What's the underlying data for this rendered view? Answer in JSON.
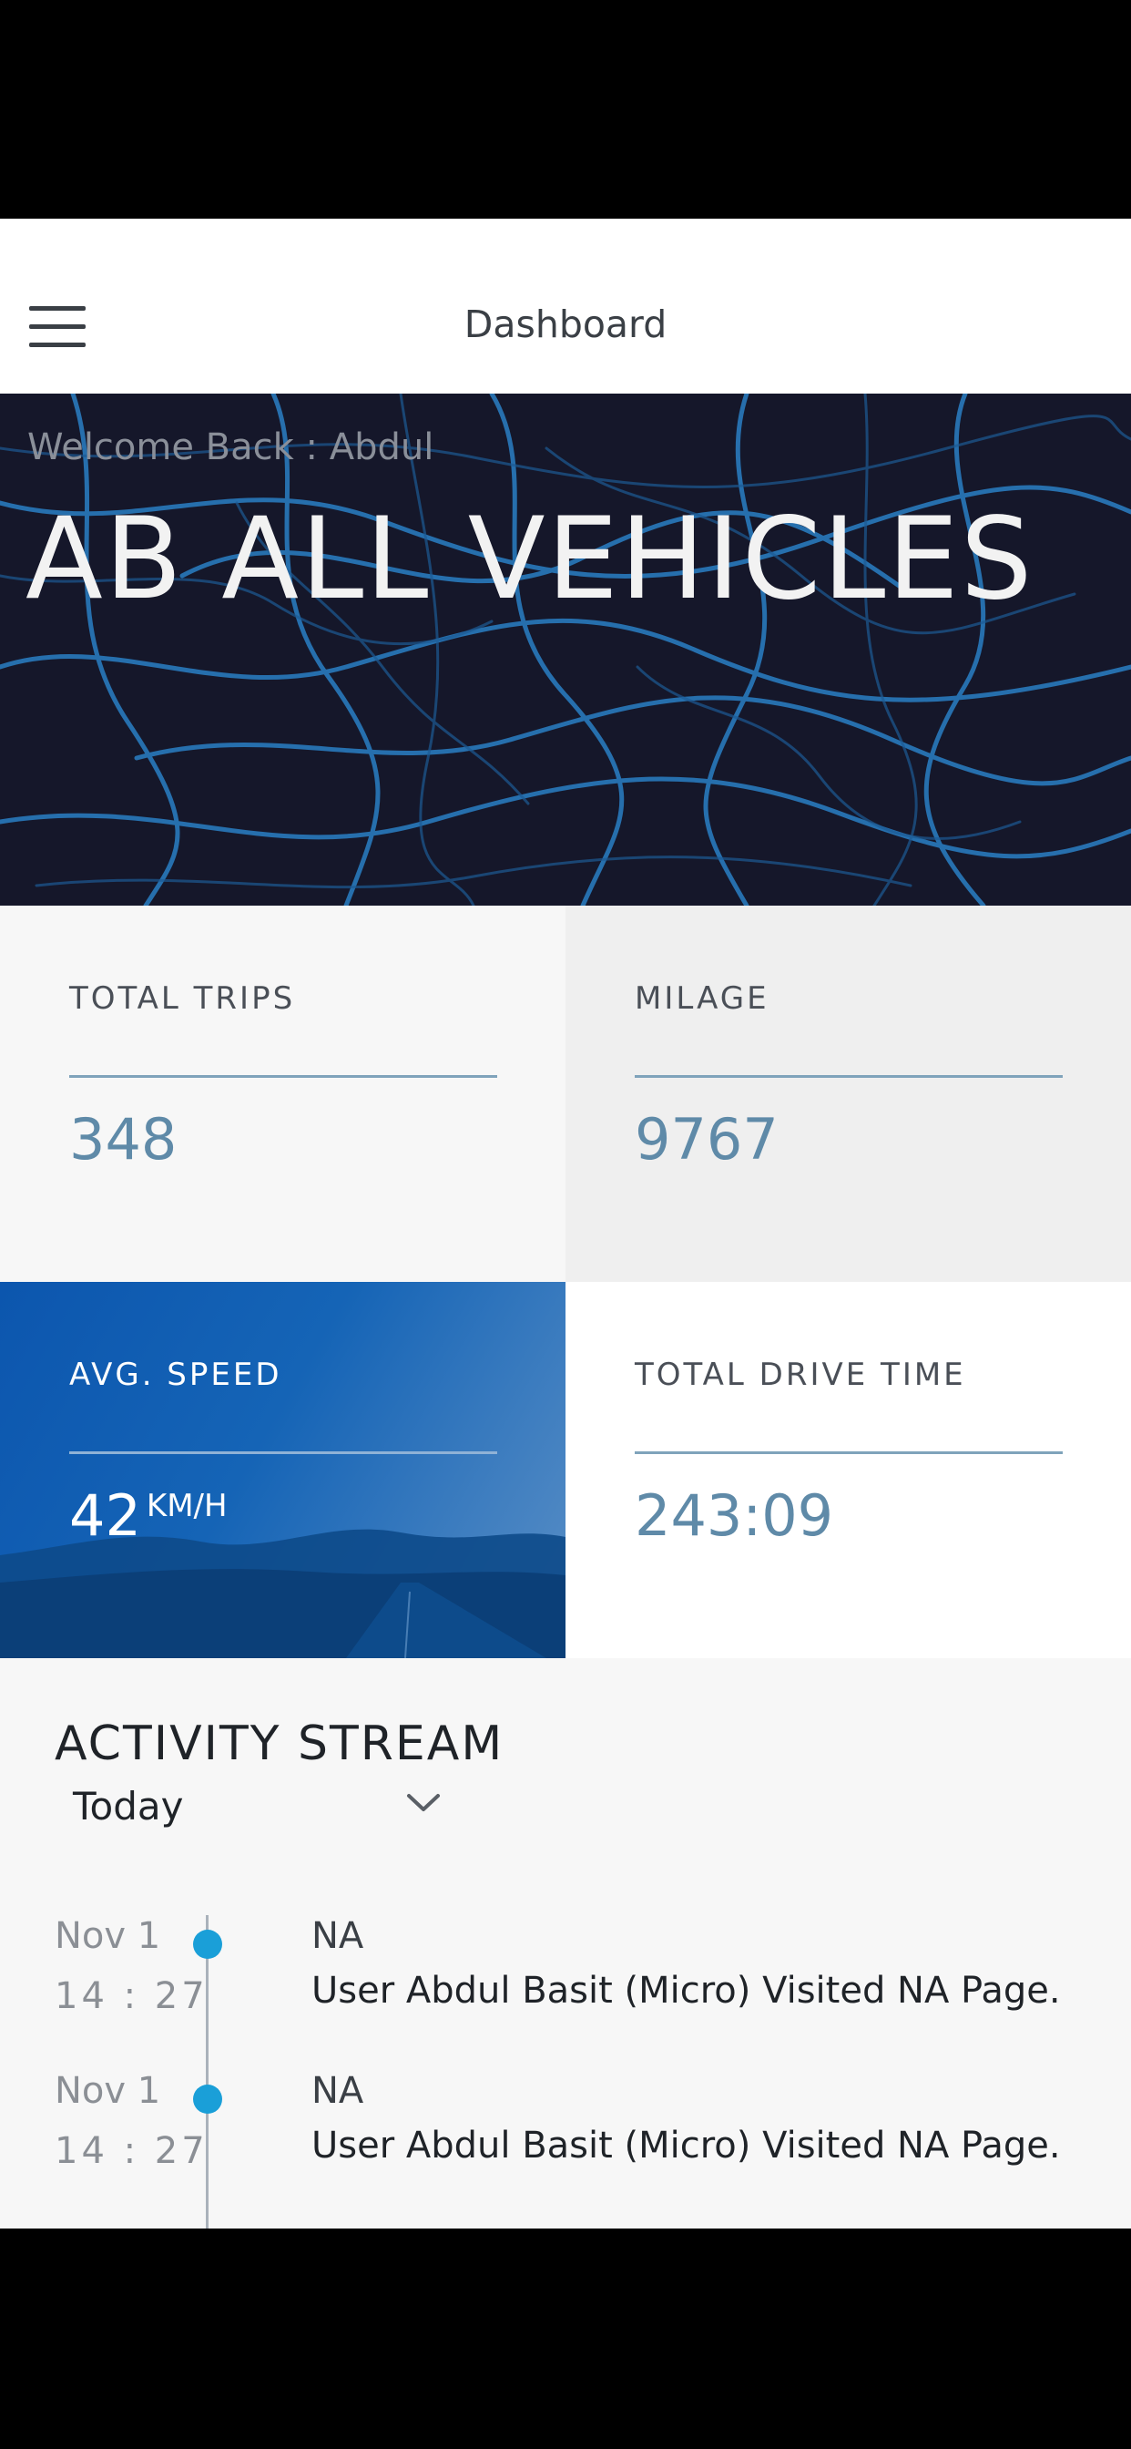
{
  "header": {
    "title": "Dashboard",
    "menu_icon": "hamburger-menu-icon"
  },
  "hero": {
    "welcome": "Welcome Back : Abdul",
    "title": "AB ALL VEHICLES"
  },
  "stats": {
    "trips": {
      "label": "TOTAL TRIPS",
      "value": "348"
    },
    "milage": {
      "label": "MILAGE",
      "value": "9767"
    },
    "speed": {
      "label": "AVG. SPEED",
      "value": "42",
      "unit": "KM/H"
    },
    "drive": {
      "label": "TOTAL DRIVE TIME",
      "value": "243:09"
    }
  },
  "activity": {
    "title": "ACTIVITY STREAM",
    "filter": "Today",
    "filter_icon": "chevron-down-icon",
    "entries": [
      {
        "date": "Nov 1",
        "time": "14 : 27",
        "title": "NA",
        "message": "User Abdul Basit (Micro) Visited NA Page."
      },
      {
        "date": "Nov 1",
        "time": "14 : 27",
        "title": "NA",
        "message": "User Abdul Basit (Micro) Visited NA Page."
      }
    ]
  },
  "colors": {
    "accent": "#5f8aa8",
    "timeline_dot": "#1a9fd8",
    "hero_bg": "#15172a",
    "speed_tile": "#0c56ae"
  }
}
